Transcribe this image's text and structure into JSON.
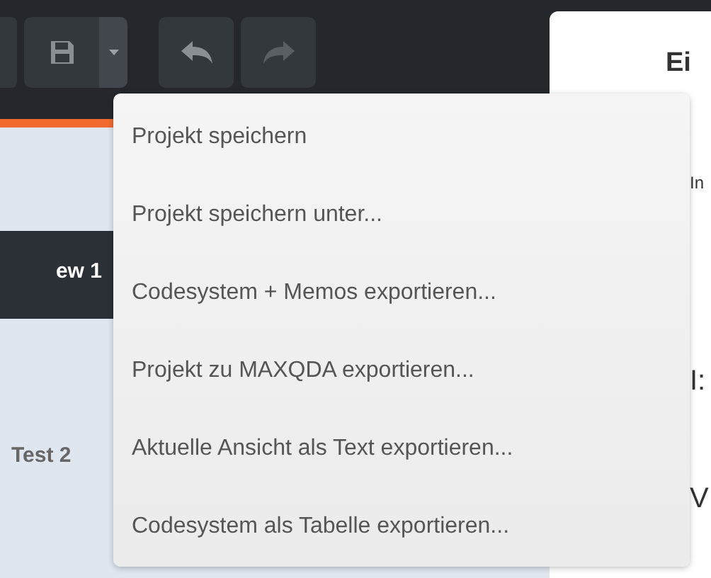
{
  "toolbar": {
    "buttons": [
      {
        "kind": "save",
        "disabled": false
      },
      {
        "kind": "undo",
        "disabled": false
      },
      {
        "kind": "redo",
        "disabled": true
      }
    ]
  },
  "sidebar": {
    "items": [
      {
        "label": "ew 1",
        "selected": true
      },
      {
        "label": "Test 2",
        "selected": false
      }
    ]
  },
  "save_menu": {
    "items": [
      "Projekt speichern",
      "Projekt speichern unter...",
      "Codesystem + Memos exportieren...",
      "Projekt zu MAXQDA exportieren...",
      "Aktuelle Ansicht als Text exportieren...",
      "Codesystem als Tabelle exportieren..."
    ]
  },
  "panel": {
    "title": "Ei",
    "texts": [
      "In",
      "I:",
      "V"
    ]
  }
}
